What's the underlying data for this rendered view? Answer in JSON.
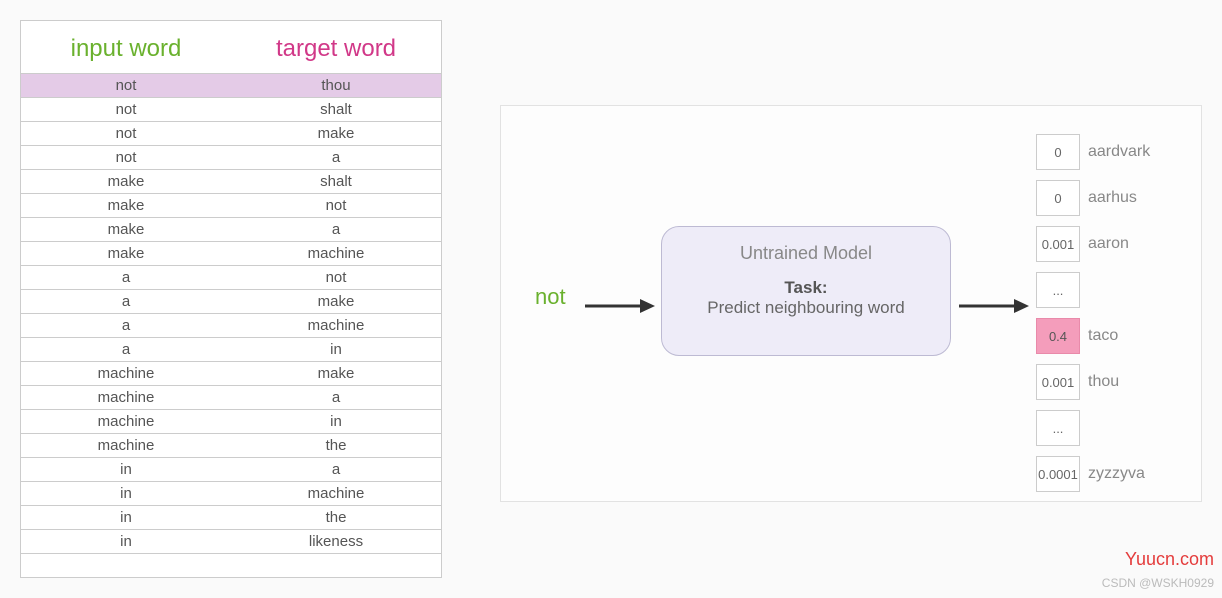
{
  "table": {
    "headers": {
      "input": "input word",
      "target": "target word"
    },
    "rows": [
      {
        "in": "not",
        "out": "thou",
        "highlight": true
      },
      {
        "in": "not",
        "out": "shalt",
        "highlight": false
      },
      {
        "in": "not",
        "out": "make",
        "highlight": false
      },
      {
        "in": "not",
        "out": "a",
        "highlight": false
      },
      {
        "in": "make",
        "out": "shalt",
        "highlight": false
      },
      {
        "in": "make",
        "out": "not",
        "highlight": false
      },
      {
        "in": "make",
        "out": "a",
        "highlight": false
      },
      {
        "in": "make",
        "out": "machine",
        "highlight": false
      },
      {
        "in": "a",
        "out": "not",
        "highlight": false
      },
      {
        "in": "a",
        "out": "make",
        "highlight": false
      },
      {
        "in": "a",
        "out": "machine",
        "highlight": false
      },
      {
        "in": "a",
        "out": "in",
        "highlight": false
      },
      {
        "in": "machine",
        "out": "make",
        "highlight": false
      },
      {
        "in": "machine",
        "out": "a",
        "highlight": false
      },
      {
        "in": "machine",
        "out": "in",
        "highlight": false
      },
      {
        "in": "machine",
        "out": "the",
        "highlight": false
      },
      {
        "in": "in",
        "out": "a",
        "highlight": false
      },
      {
        "in": "in",
        "out": "machine",
        "highlight": false
      },
      {
        "in": "in",
        "out": "the",
        "highlight": false
      },
      {
        "in": "in",
        "out": "likeness",
        "highlight": false
      }
    ]
  },
  "diagram": {
    "input_word": "not",
    "box": {
      "line1": "Untrained Model",
      "line2": "Task:",
      "line3": "Predict neighbouring word"
    },
    "outputs": [
      {
        "value": "0",
        "label": "aardvark",
        "highlight": false
      },
      {
        "value": "0",
        "label": "aarhus",
        "highlight": false
      },
      {
        "value": "0.001",
        "label": "aaron",
        "highlight": false
      },
      {
        "value": "...",
        "label": "",
        "highlight": false
      },
      {
        "value": "0.4",
        "label": "taco",
        "highlight": true
      },
      {
        "value": "0.001",
        "label": "thou",
        "highlight": false
      },
      {
        "value": "...",
        "label": "",
        "highlight": false
      },
      {
        "value": "0.0001",
        "label": "zyzzyva",
        "highlight": false
      }
    ]
  },
  "watermark": "Yuucn.com",
  "credit": "CSDN @WSKH0929"
}
